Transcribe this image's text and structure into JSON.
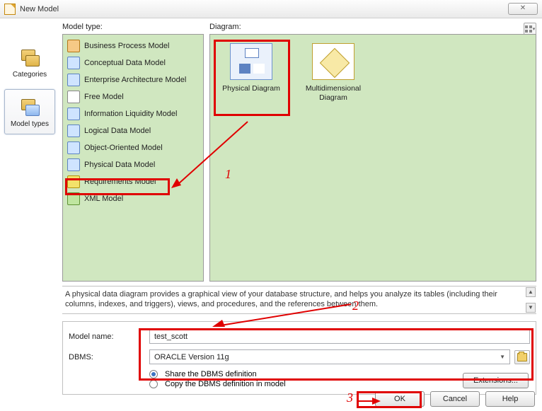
{
  "window": {
    "title": "New Model"
  },
  "nav": {
    "categories": "Categories",
    "model_types": "Model types"
  },
  "labels": {
    "model_type": "Model type:",
    "diagram": "Diagram:"
  },
  "model_types": [
    {
      "label": "Business Process Model"
    },
    {
      "label": "Conceptual Data Model"
    },
    {
      "label": "Enterprise Architecture Model"
    },
    {
      "label": "Free Model"
    },
    {
      "label": "Information Liquidity Model"
    },
    {
      "label": "Logical Data Model"
    },
    {
      "label": "Object-Oriented Model"
    },
    {
      "label": "Physical Data Model"
    },
    {
      "label": "Requirements Model"
    },
    {
      "label": "XML Model"
    }
  ],
  "diagrams": [
    {
      "label": "Physical Diagram"
    },
    {
      "label": "Multidimensional Diagram"
    }
  ],
  "description": "A physical data diagram provides a graphical view of your database structure, and helps you analyze its tables (including their columns, indexes, and triggers), views, and procedures, and the references between them.",
  "form": {
    "model_name_label": "Model name:",
    "model_name_value": "test_scott",
    "dbms_label": "DBMS:",
    "dbms_value": "ORACLE Version 11g",
    "radio_share": "Share the DBMS definition",
    "radio_copy": "Copy the DBMS definition in model",
    "extensions": "Extensions..."
  },
  "buttons": {
    "ok": "OK",
    "cancel": "Cancel",
    "help": "Help"
  },
  "annotations": {
    "n1": "1",
    "n2": "2",
    "n3": "3"
  }
}
